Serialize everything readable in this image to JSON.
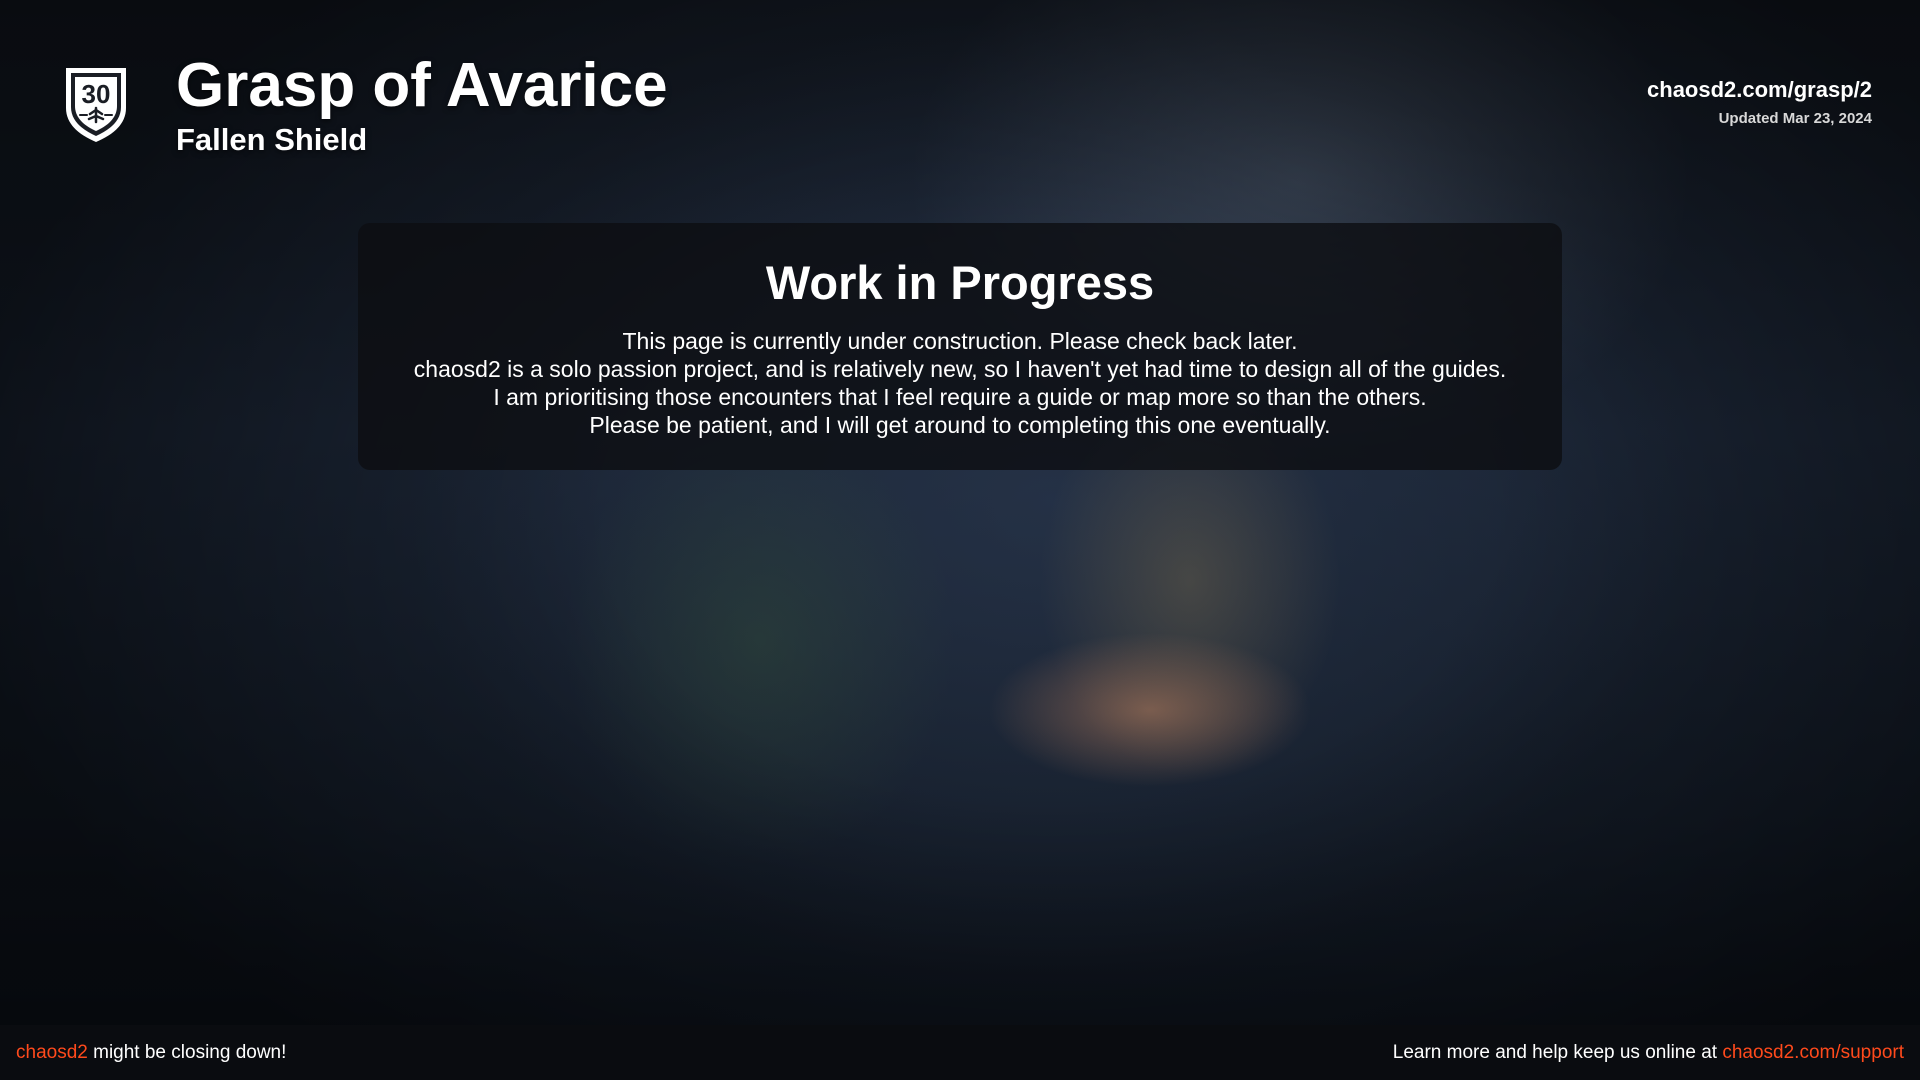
{
  "header": {
    "badge_number": "30",
    "title": "Grasp of Avarice",
    "subtitle": "Fallen Shield",
    "site_url": "chaosd2.com/grasp/2",
    "updated": "Updated Mar 23, 2024"
  },
  "notice": {
    "title": "Work in Progress",
    "lines": [
      "This page is currently under construction. Please check back later.",
      "chaosd2 is a solo passion project, and is relatively new, so I haven't yet had time to design all of the guides.",
      "I am prioritising those encounters that I feel require a guide or map more so than the others.",
      "Please be patient, and I will get around to completing this one eventually."
    ]
  },
  "footer": {
    "left_link": "chaosd2",
    "left_text": " might be closing down!",
    "right_text": "Learn more and help keep us online at ",
    "right_link": "chaosd2.com/support"
  },
  "colors": {
    "accent": "#ff4a1c",
    "panel": "#0c0e12",
    "footer_bg": "#0a0c10"
  },
  "icons": {
    "badge": "shield-badge-icon"
  }
}
